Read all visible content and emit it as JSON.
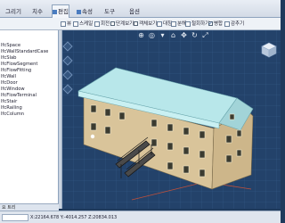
{
  "ribbon": {
    "tabs": [
      {
        "label": "그리기"
      },
      {
        "label": "치수"
      },
      {
        "label": "편집"
      },
      {
        "label": "속성"
      },
      {
        "label": "도구"
      },
      {
        "label": "옵션"
      }
    ],
    "active_tab": "편집"
  },
  "toolbar": {
    "items": [
      {
        "label": "뷰"
      },
      {
        "label": "스케일"
      },
      {
        "label": "회전"
      },
      {
        "label": "단계보기"
      },
      {
        "label": "객체보기"
      },
      {
        "label": "대칭"
      },
      {
        "label": "분해"
      },
      {
        "label": "철회하기"
      },
      {
        "label": "병합"
      },
      {
        "label": "감추기"
      }
    ]
  },
  "tree": {
    "items": [
      {
        "label": "IfcSpace"
      },
      {
        "label": "IfcWallStandardCase"
      },
      {
        "label": "IfcSlab"
      },
      {
        "label": "IfcFlowSegment"
      },
      {
        "label": "IfcFlowFitting"
      },
      {
        "label": "IfcWall"
      },
      {
        "label": "IfcDoor"
      },
      {
        "label": "IfcWindow"
      },
      {
        "label": "IfcFlowTerminal"
      },
      {
        "label": "IfcStair"
      },
      {
        "label": "IfcRailing"
      },
      {
        "label": "IfcColumn"
      }
    ],
    "footer": "요 트리"
  },
  "status": {
    "coordinates": "X:22164.678 Y:-4014.257 Z:20834.013"
  },
  "colors": {
    "viewport_bg": "#23426a",
    "grid": "#4a76aa",
    "roof": "#b8e7ea",
    "wall": "#d9c49a",
    "window": "#3b3b30"
  }
}
